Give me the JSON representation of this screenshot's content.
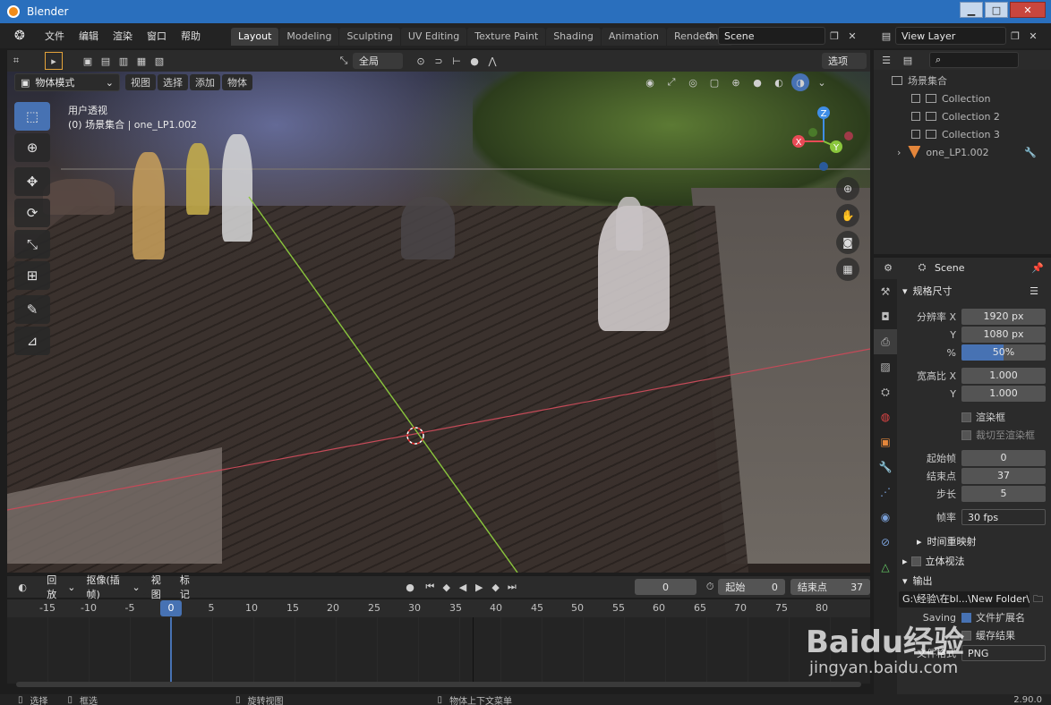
{
  "window": {
    "title": "Blender"
  },
  "menubar": {
    "items": [
      "文件",
      "编辑",
      "渲染",
      "窗口",
      "帮助"
    ],
    "workspaces": [
      "Layout",
      "Modeling",
      "Sculpting",
      "UV Editing",
      "Texture Paint",
      "Shading",
      "Animation",
      "Rendering"
    ],
    "active_workspace": "Layout",
    "scene_name": "Scene",
    "view_layer": "View Layer"
  },
  "viewport": {
    "transform_orientation": "全局",
    "options_label": "选项",
    "mode": "物体模式",
    "header_menus": [
      "视图",
      "选择",
      "添加",
      "物体"
    ],
    "overlay_line1": "用户透视",
    "overlay_line2": "(0) 场景集合 | one_LP1.002",
    "gizmo_axes": {
      "x": "X",
      "y": "Y",
      "z": "Z"
    },
    "colors": {
      "x_axis": "#e94a56",
      "y_axis": "#8ac63c",
      "z_axis": "#3f8ee6",
      "accent": "#4772b3"
    }
  },
  "outliner": {
    "root": "场景集合",
    "items": [
      {
        "label": "Collection"
      },
      {
        "label": "Collection 2"
      },
      {
        "label": "Collection 3"
      },
      {
        "label": "one_LP1.002"
      }
    ]
  },
  "properties": {
    "header": "Scene",
    "panel_dimensions": "规格尺寸",
    "resolution_x_label": "分辨率 X",
    "resolution_x": "1920 px",
    "resolution_y_label": "Y",
    "resolution_y": "1080 px",
    "percent_label": "%",
    "percent": "50%",
    "percent_value": 50,
    "aspect_x_label": "宽高比 X",
    "aspect_x": "1.000",
    "aspect_y_label": "Y",
    "aspect_y": "1.000",
    "render_region": "渲染框",
    "crop_region": "裁切至渲染框",
    "frame_start_label": "起始帧",
    "frame_start": "0",
    "frame_end_label": "结束点",
    "frame_end": "37",
    "frame_step_label": "步长",
    "frame_step": "5",
    "fps_label": "帧率",
    "fps": "30 fps",
    "time_remap": "时间重映射",
    "stereoscopy": "立体视法",
    "output": "输出",
    "output_path": "G:\\经验\\在bl...\\New Folder\\",
    "saving": "Saving",
    "file_ext": "文件扩展名",
    "cache_result": "缓存结果",
    "file_format_label": "文件格式",
    "file_format": "PNG"
  },
  "timeline": {
    "menus": [
      "回放",
      "抠像(插帧)",
      "视图",
      "标记"
    ],
    "current_frame": "0",
    "start_label": "起始",
    "start": "0",
    "end_label": "结束点",
    "end": "37",
    "ticks": [
      "-15",
      "-10",
      "-5",
      "0",
      "5",
      "10",
      "15",
      "20",
      "25",
      "30",
      "35",
      "40",
      "45",
      "50",
      "55",
      "60",
      "65",
      "70",
      "75",
      "80"
    ]
  },
  "statusbar": {
    "select": "选择",
    "box_select": "框选",
    "rotate_view": "旋转视图",
    "context_menu": "物体上下文菜单",
    "version": "2.90.0"
  },
  "watermark": {
    "brand": "Baidu经验",
    "url": "jingyan.baidu.com"
  }
}
